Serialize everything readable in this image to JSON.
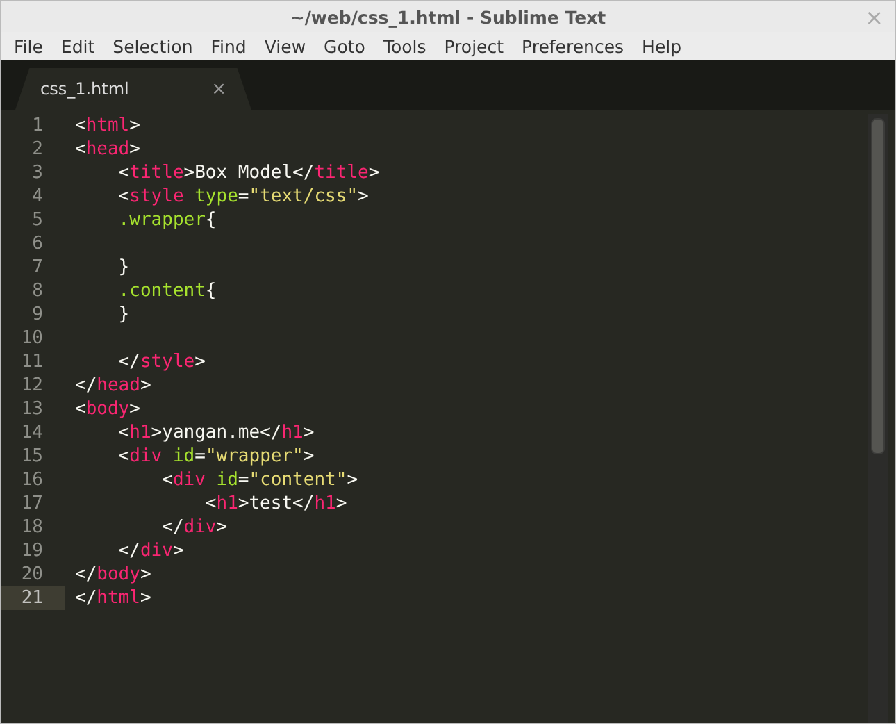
{
  "window": {
    "title": "~/web/css_1.html - Sublime Text",
    "close": "×"
  },
  "menu": [
    "File",
    "Edit",
    "Selection",
    "Find",
    "View",
    "Goto",
    "Tools",
    "Project",
    "Preferences",
    "Help"
  ],
  "tabs": [
    {
      "label": "css_1.html",
      "close": "×",
      "selected": true
    }
  ],
  "lines": [
    {
      "number": "1",
      "current": false,
      "tokens": [
        {
          "kind": "p",
          "text": "<"
        },
        {
          "kind": "t",
          "text": "html"
        },
        {
          "kind": "p",
          "text": ">"
        }
      ]
    },
    {
      "number": "2",
      "current": false,
      "tokens": [
        {
          "kind": "p",
          "text": "<"
        },
        {
          "kind": "t",
          "text": "head"
        },
        {
          "kind": "p",
          "text": ">"
        }
      ]
    },
    {
      "number": "3",
      "current": false,
      "tokens": [
        {
          "kind": "p",
          "text": "    <"
        },
        {
          "kind": "t",
          "text": "title"
        },
        {
          "kind": "p",
          "text": ">Box Model</"
        },
        {
          "kind": "t",
          "text": "title"
        },
        {
          "kind": "p",
          "text": ">"
        }
      ]
    },
    {
      "number": "4",
      "current": false,
      "tokens": [
        {
          "kind": "p",
          "text": "    <"
        },
        {
          "kind": "t",
          "text": "style "
        },
        {
          "kind": "a",
          "text": "type"
        },
        {
          "kind": "p",
          "text": "="
        },
        {
          "kind": "s",
          "text": "\"text/css\""
        },
        {
          "kind": "p",
          "text": ">"
        }
      ]
    },
    {
      "number": "5",
      "current": false,
      "tokens": [
        {
          "kind": "a",
          "text": "    .wrapper"
        },
        {
          "kind": "p",
          "text": "{"
        }
      ]
    },
    {
      "number": "6",
      "current": false
    },
    {
      "number": "7",
      "current": false,
      "tokens": [
        {
          "kind": "p",
          "text": "    }"
        }
      ]
    },
    {
      "number": "8",
      "current": false,
      "tokens": [
        {
          "kind": "a",
          "text": "    .content"
        },
        {
          "kind": "p",
          "text": "{"
        }
      ]
    },
    {
      "number": "9",
      "current": false,
      "tokens": [
        {
          "kind": "p",
          "text": "    }"
        }
      ]
    },
    {
      "number": "10",
      "current": false
    },
    {
      "number": "11",
      "current": false,
      "tokens": [
        {
          "kind": "p",
          "text": "    </"
        },
        {
          "kind": "t",
          "text": "style"
        },
        {
          "kind": "p",
          "text": ">"
        }
      ]
    },
    {
      "number": "12",
      "current": false,
      "tokens": [
        {
          "kind": "p",
          "text": "</"
        },
        {
          "kind": "t",
          "text": "head"
        },
        {
          "kind": "p",
          "text": ">"
        }
      ]
    },
    {
      "number": "13",
      "current": false,
      "tokens": [
        {
          "kind": "p",
          "text": "<"
        },
        {
          "kind": "t",
          "text": "body"
        },
        {
          "kind": "p",
          "text": ">"
        }
      ]
    },
    {
      "number": "14",
      "current": false,
      "tokens": [
        {
          "kind": "p",
          "text": "    <"
        },
        {
          "kind": "t",
          "text": "h1"
        },
        {
          "kind": "p",
          "text": ">yangan.me</"
        },
        {
          "kind": "t",
          "text": "h1"
        },
        {
          "kind": "p",
          "text": ">"
        }
      ]
    },
    {
      "number": "15",
      "current": false,
      "tokens": [
        {
          "kind": "p",
          "text": "    <"
        },
        {
          "kind": "t",
          "text": "div "
        },
        {
          "kind": "a",
          "text": "id"
        },
        {
          "kind": "p",
          "text": "="
        },
        {
          "kind": "s",
          "text": "\"wrapper\""
        },
        {
          "kind": "p",
          "text": ">"
        }
      ]
    },
    {
      "number": "16",
      "current": false,
      "tokens": [
        {
          "kind": "p",
          "text": "        <"
        },
        {
          "kind": "t",
          "text": "div "
        },
        {
          "kind": "a",
          "text": "id"
        },
        {
          "kind": "p",
          "text": "="
        },
        {
          "kind": "s",
          "text": "\"content\""
        },
        {
          "kind": "p",
          "text": ">"
        }
      ]
    },
    {
      "number": "17",
      "current": false,
      "tokens": [
        {
          "kind": "p",
          "text": "            <"
        },
        {
          "kind": "t",
          "text": "h1"
        },
        {
          "kind": "p",
          "text": ">test</"
        },
        {
          "kind": "t",
          "text": "h1"
        },
        {
          "kind": "p",
          "text": ">"
        }
      ]
    },
    {
      "number": "18",
      "current": false,
      "tokens": [
        {
          "kind": "p",
          "text": "        </"
        },
        {
          "kind": "t",
          "text": "div"
        },
        {
          "kind": "p",
          "text": ">"
        }
      ]
    },
    {
      "number": "19",
      "current": false,
      "tokens": [
        {
          "kind": "p",
          "text": "    </"
        },
        {
          "kind": "t",
          "text": "div"
        },
        {
          "kind": "p",
          "text": ">"
        }
      ]
    },
    {
      "number": "20",
      "current": false,
      "tokens": [
        {
          "kind": "p",
          "text": "</"
        },
        {
          "kind": "t",
          "text": "body"
        },
        {
          "kind": "p",
          "text": ">"
        }
      ]
    },
    {
      "number": "21",
      "current": true,
      "tokens": [
        {
          "kind": "p",
          "text": "</"
        },
        {
          "kind": "t",
          "text": "html"
        },
        {
          "kind": "p",
          "text": ">"
        }
      ]
    }
  ]
}
